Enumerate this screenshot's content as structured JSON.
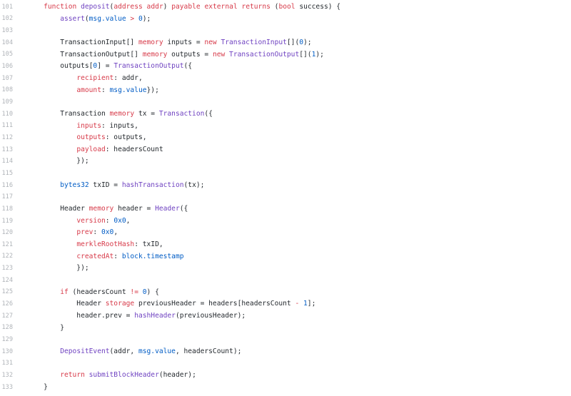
{
  "code": {
    "lines": [
      {
        "n": "101",
        "tokens": [
          {
            "t": "    ",
            "c": "d"
          },
          {
            "t": "function",
            "c": "k"
          },
          {
            "t": " ",
            "c": "d"
          },
          {
            "t": "deposit",
            "c": "f"
          },
          {
            "t": "(",
            "c": "d"
          },
          {
            "t": "address",
            "c": "k"
          },
          {
            "t": " ",
            "c": "d"
          },
          {
            "t": "addr",
            "c": "k"
          },
          {
            "t": ") ",
            "c": "d"
          },
          {
            "t": "payable",
            "c": "k"
          },
          {
            "t": " ",
            "c": "d"
          },
          {
            "t": "external",
            "c": "k"
          },
          {
            "t": " ",
            "c": "d"
          },
          {
            "t": "returns",
            "c": "k"
          },
          {
            "t": " (",
            "c": "d"
          },
          {
            "t": "bool",
            "c": "k"
          },
          {
            "t": " success) {",
            "c": "d"
          }
        ]
      },
      {
        "n": "102",
        "tokens": [
          {
            "t": "        ",
            "c": "d"
          },
          {
            "t": "assert",
            "c": "f"
          },
          {
            "t": "(",
            "c": "d"
          },
          {
            "t": "msg.value",
            "c": "n"
          },
          {
            "t": " > ",
            "c": "k"
          },
          {
            "t": "0",
            "c": "n"
          },
          {
            "t": ");",
            "c": "d"
          }
        ]
      },
      {
        "n": "103",
        "tokens": []
      },
      {
        "n": "104",
        "tokens": [
          {
            "t": "        TransactionInput[] ",
            "c": "d"
          },
          {
            "t": "memory",
            "c": "k"
          },
          {
            "t": " inputs = ",
            "c": "d"
          },
          {
            "t": "new",
            "c": "k"
          },
          {
            "t": " ",
            "c": "d"
          },
          {
            "t": "TransactionInput",
            "c": "f"
          },
          {
            "t": "[](",
            "c": "d"
          },
          {
            "t": "0",
            "c": "n"
          },
          {
            "t": ");",
            "c": "d"
          }
        ]
      },
      {
        "n": "105",
        "tokens": [
          {
            "t": "        TransactionOutput[] ",
            "c": "d"
          },
          {
            "t": "memory",
            "c": "k"
          },
          {
            "t": " outputs = ",
            "c": "d"
          },
          {
            "t": "new",
            "c": "k"
          },
          {
            "t": " ",
            "c": "d"
          },
          {
            "t": "TransactionOutput",
            "c": "f"
          },
          {
            "t": "[](",
            "c": "d"
          },
          {
            "t": "1",
            "c": "n"
          },
          {
            "t": ");",
            "c": "d"
          }
        ]
      },
      {
        "n": "106",
        "tokens": [
          {
            "t": "        outputs[",
            "c": "d"
          },
          {
            "t": "0",
            "c": "n"
          },
          {
            "t": "] = ",
            "c": "d"
          },
          {
            "t": "TransactionOutput",
            "c": "f"
          },
          {
            "t": "({",
            "c": "d"
          }
        ]
      },
      {
        "n": "107",
        "tokens": [
          {
            "t": "            ",
            "c": "d"
          },
          {
            "t": "recipient",
            "c": "k"
          },
          {
            "t": ": addr,",
            "c": "d"
          }
        ]
      },
      {
        "n": "108",
        "tokens": [
          {
            "t": "            ",
            "c": "d"
          },
          {
            "t": "amount",
            "c": "k"
          },
          {
            "t": ": ",
            "c": "d"
          },
          {
            "t": "msg.value",
            "c": "n"
          },
          {
            "t": "});",
            "c": "d"
          }
        ]
      },
      {
        "n": "109",
        "tokens": []
      },
      {
        "n": "110",
        "tokens": [
          {
            "t": "        Transaction ",
            "c": "d"
          },
          {
            "t": "memory",
            "c": "k"
          },
          {
            "t": " tx = ",
            "c": "d"
          },
          {
            "t": "Transaction",
            "c": "f"
          },
          {
            "t": "({",
            "c": "d"
          }
        ]
      },
      {
        "n": "111",
        "tokens": [
          {
            "t": "            ",
            "c": "d"
          },
          {
            "t": "inputs",
            "c": "k"
          },
          {
            "t": ": inputs,",
            "c": "d"
          }
        ]
      },
      {
        "n": "112",
        "tokens": [
          {
            "t": "            ",
            "c": "d"
          },
          {
            "t": "outputs",
            "c": "k"
          },
          {
            "t": ": outputs,",
            "c": "d"
          }
        ]
      },
      {
        "n": "113",
        "tokens": [
          {
            "t": "            ",
            "c": "d"
          },
          {
            "t": "payload",
            "c": "k"
          },
          {
            "t": ": headersCount",
            "c": "d"
          }
        ]
      },
      {
        "n": "114",
        "tokens": [
          {
            "t": "            });",
            "c": "d"
          }
        ]
      },
      {
        "n": "115",
        "tokens": []
      },
      {
        "n": "116",
        "tokens": [
          {
            "t": "        ",
            "c": "d"
          },
          {
            "t": "bytes32",
            "c": "n"
          },
          {
            "t": " txID = ",
            "c": "d"
          },
          {
            "t": "hashTransaction",
            "c": "f"
          },
          {
            "t": "(tx);",
            "c": "d"
          }
        ]
      },
      {
        "n": "117",
        "tokens": []
      },
      {
        "n": "118",
        "tokens": [
          {
            "t": "        Header ",
            "c": "d"
          },
          {
            "t": "memory",
            "c": "k"
          },
          {
            "t": " header = ",
            "c": "d"
          },
          {
            "t": "Header",
            "c": "f"
          },
          {
            "t": "({",
            "c": "d"
          }
        ]
      },
      {
        "n": "119",
        "tokens": [
          {
            "t": "            ",
            "c": "d"
          },
          {
            "t": "version",
            "c": "k"
          },
          {
            "t": ": ",
            "c": "d"
          },
          {
            "t": "0x0",
            "c": "n"
          },
          {
            "t": ",",
            "c": "d"
          }
        ]
      },
      {
        "n": "120",
        "tokens": [
          {
            "t": "            ",
            "c": "d"
          },
          {
            "t": "prev",
            "c": "k"
          },
          {
            "t": ": ",
            "c": "d"
          },
          {
            "t": "0x0",
            "c": "n"
          },
          {
            "t": ",",
            "c": "d"
          }
        ]
      },
      {
        "n": "121",
        "tokens": [
          {
            "t": "            ",
            "c": "d"
          },
          {
            "t": "merkleRootHash",
            "c": "k"
          },
          {
            "t": ": txID,",
            "c": "d"
          }
        ]
      },
      {
        "n": "122",
        "tokens": [
          {
            "t": "            ",
            "c": "d"
          },
          {
            "t": "createdAt",
            "c": "k"
          },
          {
            "t": ": ",
            "c": "d"
          },
          {
            "t": "block.timestamp",
            "c": "n"
          }
        ]
      },
      {
        "n": "123",
        "tokens": [
          {
            "t": "            });",
            "c": "d"
          }
        ]
      },
      {
        "n": "124",
        "tokens": []
      },
      {
        "n": "125",
        "tokens": [
          {
            "t": "        ",
            "c": "d"
          },
          {
            "t": "if",
            "c": "k"
          },
          {
            "t": " (headersCount ",
            "c": "d"
          },
          {
            "t": "!=",
            "c": "k"
          },
          {
            "t": " ",
            "c": "d"
          },
          {
            "t": "0",
            "c": "n"
          },
          {
            "t": ") {",
            "c": "d"
          }
        ]
      },
      {
        "n": "126",
        "tokens": [
          {
            "t": "            Header ",
            "c": "d"
          },
          {
            "t": "storage",
            "c": "k"
          },
          {
            "t": " previousHeader = headers[headersCount ",
            "c": "d"
          },
          {
            "t": "-",
            "c": "k"
          },
          {
            "t": " ",
            "c": "d"
          },
          {
            "t": "1",
            "c": "n"
          },
          {
            "t": "];",
            "c": "d"
          }
        ]
      },
      {
        "n": "127",
        "tokens": [
          {
            "t": "            header.prev = ",
            "c": "d"
          },
          {
            "t": "hashHeader",
            "c": "f"
          },
          {
            "t": "(previousHeader);",
            "c": "d"
          }
        ]
      },
      {
        "n": "128",
        "tokens": [
          {
            "t": "        }",
            "c": "d"
          }
        ]
      },
      {
        "n": "129",
        "tokens": []
      },
      {
        "n": "130",
        "tokens": [
          {
            "t": "        ",
            "c": "d"
          },
          {
            "t": "DepositEvent",
            "c": "f"
          },
          {
            "t": "(addr, ",
            "c": "d"
          },
          {
            "t": "msg.value",
            "c": "n"
          },
          {
            "t": ", headersCount);",
            "c": "d"
          }
        ]
      },
      {
        "n": "131",
        "tokens": []
      },
      {
        "n": "132",
        "tokens": [
          {
            "t": "        ",
            "c": "d"
          },
          {
            "t": "return",
            "c": "k"
          },
          {
            "t": " ",
            "c": "d"
          },
          {
            "t": "submitBlockHeader",
            "c": "f"
          },
          {
            "t": "(header);",
            "c": "d"
          }
        ]
      },
      {
        "n": "133",
        "tokens": [
          {
            "t": "    }",
            "c": "d"
          }
        ]
      }
    ]
  }
}
